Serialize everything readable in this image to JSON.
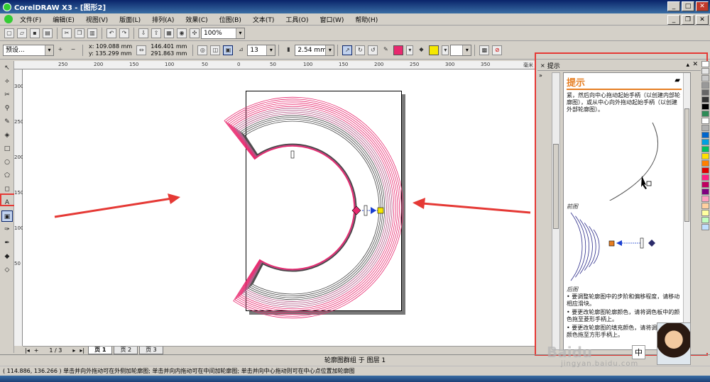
{
  "window": {
    "title": "CorelDRAW X3 - [图形2]"
  },
  "menu": [
    "文件(F)",
    "编辑(E)",
    "视图(V)",
    "版面(L)",
    "排列(A)",
    "效果(C)",
    "位图(B)",
    "文本(T)",
    "工具(O)",
    "窗口(W)",
    "帮助(H)"
  ],
  "toolbar1": {
    "zoom": "100%"
  },
  "toolbar2": {
    "preset": "预设...",
    "x": "x: 109.088 mm",
    "y": "y: 135.299 mm",
    "width": "146.401 mm",
    "height": "291.863 mm",
    "steps": "13",
    "offset": "2.54 mm",
    "colors": {
      "outline": "#e8286e",
      "fill": "#f5e800"
    }
  },
  "rulers": {
    "h_ticks": [
      "250",
      "200",
      "150",
      "100",
      "50",
      "0",
      "50",
      "100",
      "150",
      "200",
      "250",
      "300",
      "350",
      "400",
      "450"
    ],
    "h_unit": "毫米",
    "v_ticks": [
      "300",
      "250",
      "200",
      "150",
      "100",
      "50"
    ]
  },
  "pages": {
    "counter": "1 / 3",
    "tabs": [
      "页 1",
      "页 2",
      "页 3"
    ]
  },
  "docker": {
    "header": "提示",
    "title": "提示",
    "intro": "紧，然后向中心拖动起始手柄（以创建内部轮廓图），或从中心向外拖动起始手柄（以创建外部轮廓图）。",
    "label_before": "前图",
    "label_after": "后图",
    "bullets": [
      "要调整轮廓图中的步阶和偏移程度，请移动相应滑块。",
      "要更改轮廓图轮廓颜色，请将调色板中的颜色拖至菱形手柄上。",
      "要更改轮廓图的填充颜色，请将调色板中的颜色拖至方形手柄上。"
    ]
  },
  "palette": [
    "#ffffff",
    "#e6e6e6",
    "#c8c8c8",
    "#999999",
    "#666666",
    "#333333",
    "#000000",
    "#2e8b57",
    "#ffffff",
    "#b0b0b0",
    "#0066cc",
    "#00a0e0",
    "#00c060",
    "#ffe000",
    "#ff8000",
    "#e00000",
    "#ff2080",
    "#c00060",
    "#800080",
    "#ffa0c0",
    "#ffd0a0",
    "#ffffa0",
    "#c0ffc0",
    "#c0e0ff"
  ],
  "status": {
    "line1": "轮廓图群组 于 图层 1",
    "line2": "( 114.886, 136.266 )   单击并向外拖动可在外侧加轮廓图; 单击并向内拖动可在中间加轮廓图; 单击并向中心拖动则可在中心点位置加轮廓图"
  },
  "watermark": {
    "brand": "Baidu",
    "site": "jingyan.baidu.com",
    "ime": "中"
  }
}
